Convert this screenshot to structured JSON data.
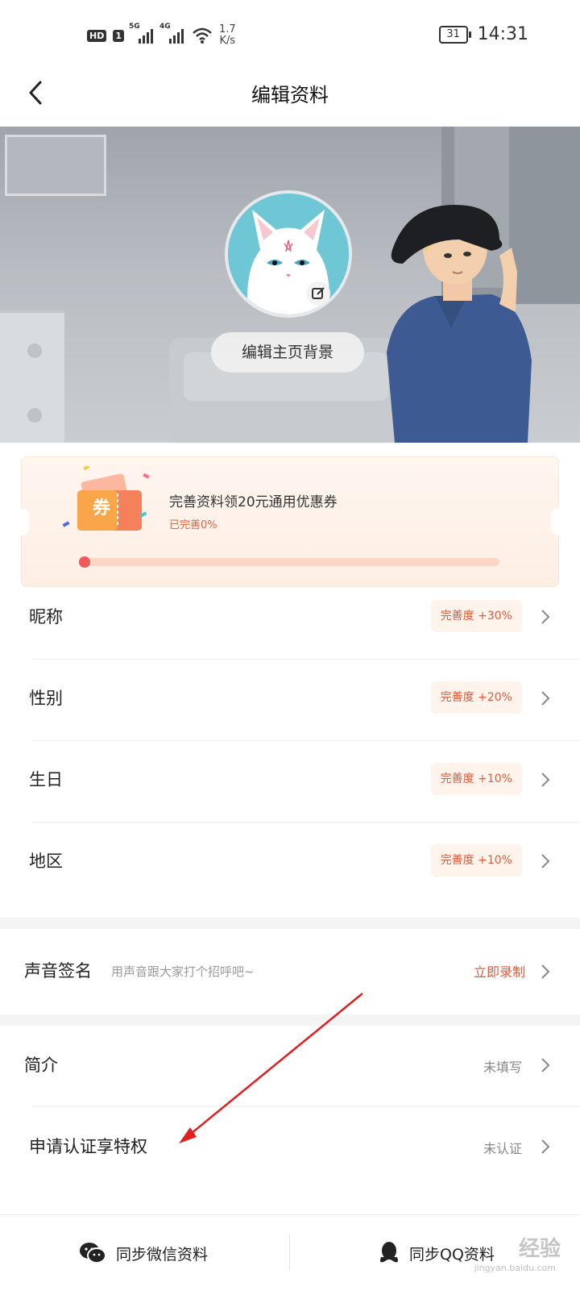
{
  "status_bar": {
    "hd": "HD",
    "sim": "1",
    "net1": "5G",
    "net2": "4G",
    "speed_value": "1.7",
    "speed_unit": "K/s",
    "battery": "31",
    "time": "14:31"
  },
  "header": {
    "title": "编辑资料"
  },
  "banner": {
    "edit_background_label": "编辑主页背景"
  },
  "coupon": {
    "title": "完善资料领20元通用优惠券",
    "progress_text": "已完善0%",
    "ticket_label": "券",
    "progress": 0.0
  },
  "profile_rows": [
    {
      "label": "昵称",
      "badge": "完善度 +30%"
    },
    {
      "label": "性别",
      "badge": "完善度 +20%"
    },
    {
      "label": "生日",
      "badge": "完善度 +10%"
    },
    {
      "label": "地区",
      "badge": "完善度 +10%"
    }
  ],
  "voice": {
    "label": "声音签名",
    "hint": "用声音跟大家打个招呼吧~",
    "action": "立即录制"
  },
  "intro": {
    "label": "简介",
    "value": "未填写"
  },
  "verify": {
    "label": "申请认证享特权",
    "value": "未认证"
  },
  "bottom": {
    "wechat_label": "同步微信资料",
    "qq_label": "同步QQ资料"
  },
  "watermark": {
    "main": "经验",
    "sub": "jingyan.baidu.com"
  },
  "colors": {
    "accent": "#e2593b",
    "progress": "#f56a6a",
    "annotation_arrow": "#e02020"
  }
}
